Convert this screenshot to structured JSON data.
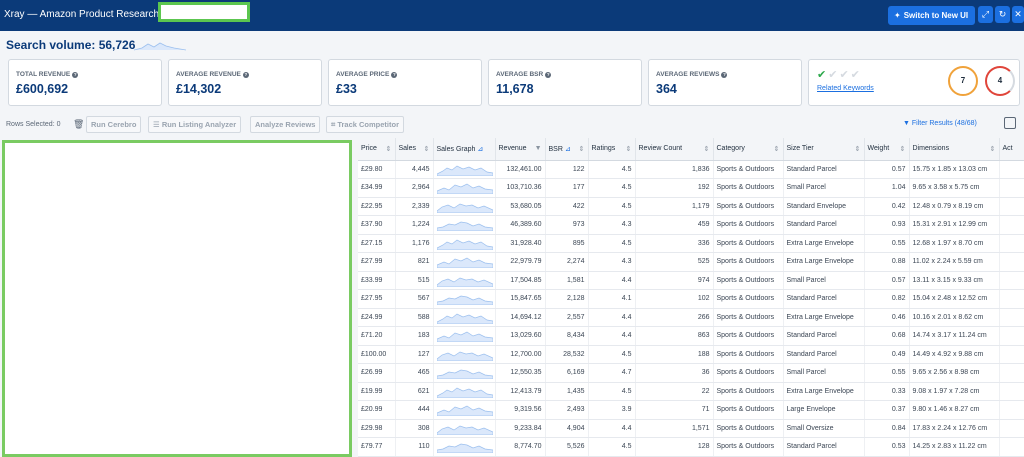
{
  "header": {
    "title": "Xray — Amazon Product Research for",
    "switch_label": "Switch to New UI"
  },
  "search_volume": {
    "text": "Search volume: 56,726"
  },
  "cards": [
    {
      "label": "TOTAL REVENUE",
      "value": "£600,692"
    },
    {
      "label": "AVERAGE REVENUE",
      "value": "£14,302"
    },
    {
      "label": "AVERAGE PRICE",
      "value": "£33"
    },
    {
      "label": "AVERAGE BSR",
      "value": "11,678"
    },
    {
      "label": "AVERAGE REVIEWS",
      "value": "364"
    }
  ],
  "keywords_card": {
    "link": "Related Keywords",
    "score_a": "7",
    "score_b": "4",
    "checks_done": 1,
    "checks_total": 4
  },
  "toolbar": {
    "rows_selected": "Rows Selected: 0",
    "run_cerebro": "Run Cerebro",
    "run_listing": "Run Listing Analyzer",
    "analyze_reviews": "Analyze Reviews",
    "track_competitor": "Track Competitor",
    "filter_results": "Filter Results (48/68)"
  },
  "table": {
    "columns": [
      "Price",
      "Sales",
      "Sales Graph",
      "Revenue",
      "BSR",
      "Ratings",
      "Review Count",
      "Category",
      "Size Tier",
      "Weight",
      "Dimensions",
      "Act"
    ],
    "rows": [
      [
        "£29.80",
        "4,445",
        "132,461.00",
        "122",
        "4.5",
        "1,836",
        "Sports & Outdoors",
        "Standard Parcel",
        "0.57",
        "15.75 x 1.85 x 13.03 cm"
      ],
      [
        "£34.99",
        "2,964",
        "103,710.36",
        "177",
        "4.5",
        "192",
        "Sports & Outdoors",
        "Small Parcel",
        "1.04",
        "9.65 x 3.58 x 5.75 cm"
      ],
      [
        "£22.95",
        "2,339",
        "53,680.05",
        "422",
        "4.5",
        "1,179",
        "Sports & Outdoors",
        "Standard Envelope",
        "0.42",
        "12.48 x 0.79 x 8.19 cm"
      ],
      [
        "£37.90",
        "1,224",
        "46,389.60",
        "973",
        "4.3",
        "459",
        "Sports & Outdoors",
        "Standard Parcel",
        "0.93",
        "15.31 x 2.91 x 12.99 cm"
      ],
      [
        "£27.15",
        "1,176",
        "31,928.40",
        "895",
        "4.5",
        "336",
        "Sports & Outdoors",
        "Extra Large Envelope",
        "0.55",
        "12.68 x 1.97 x 8.70 cm"
      ],
      [
        "£27.99",
        "821",
        "22,979.79",
        "2,274",
        "4.3",
        "525",
        "Sports & Outdoors",
        "Extra Large Envelope",
        "0.88",
        "11.02 x 2.24 x 5.59 cm"
      ],
      [
        "£33.99",
        "515",
        "17,504.85",
        "1,581",
        "4.4",
        "974",
        "Sports & Outdoors",
        "Small Parcel",
        "0.57",
        "13.11 x 3.15 x 9.33 cm"
      ],
      [
        "£27.95",
        "567",
        "15,847.65",
        "2,128",
        "4.1",
        "102",
        "Sports & Outdoors",
        "Standard Parcel",
        "0.82",
        "15.04 x 2.48 x 12.52 cm"
      ],
      [
        "£24.99",
        "588",
        "14,694.12",
        "2,557",
        "4.4",
        "266",
        "Sports & Outdoors",
        "Extra Large Envelope",
        "0.46",
        "10.16 x 2.01 x 8.62 cm"
      ],
      [
        "£71.20",
        "183",
        "13,029.60",
        "8,434",
        "4.4",
        "863",
        "Sports & Outdoors",
        "Standard Parcel",
        "0.68",
        "14.74 x 3.17 x 11.24 cm"
      ],
      [
        "£100.00",
        "127",
        "12,700.00",
        "28,532",
        "4.5",
        "188",
        "Sports & Outdoors",
        "Standard Parcel",
        "0.49",
        "14.49 x 4.92 x 9.88 cm"
      ],
      [
        "£26.99",
        "465",
        "12,550.35",
        "6,169",
        "4.7",
        "36",
        "Sports & Outdoors",
        "Small Parcel",
        "0.55",
        "9.65 x 2.56 x 8.98 cm"
      ],
      [
        "£19.99",
        "621",
        "12,413.79",
        "1,435",
        "4.5",
        "22",
        "Sports & Outdoors",
        "Extra Large Envelope",
        "0.33",
        "9.08 x 1.97 x 7.28 cm"
      ],
      [
        "£20.99",
        "444",
        "9,319.56",
        "2,493",
        "3.9",
        "71",
        "Sports & Outdoors",
        "Large Envelope",
        "0.37",
        "9.80 x 1.46 x 8.27 cm"
      ],
      [
        "£29.98",
        "308",
        "9,233.84",
        "4,904",
        "4.4",
        "1,571",
        "Sports & Outdoors",
        "Small Oversize",
        "0.84",
        "17.83 x 2.24 x 12.76 cm"
      ],
      [
        "£79.77",
        "110",
        "8,774.70",
        "5,526",
        "4.5",
        "128",
        "Sports & Outdoors",
        "Standard Parcel",
        "0.53",
        "14.25 x 2.83 x 11.22 cm"
      ]
    ]
  },
  "colors": {
    "header_bg": "#0b3a79",
    "accent": "#1b6fe0",
    "redact_border": "#5cc64f"
  },
  "icons": {
    "switch": "sparkle-icon",
    "expand": "expand-icon",
    "refresh": "refresh-icon",
    "close": "close-icon"
  }
}
